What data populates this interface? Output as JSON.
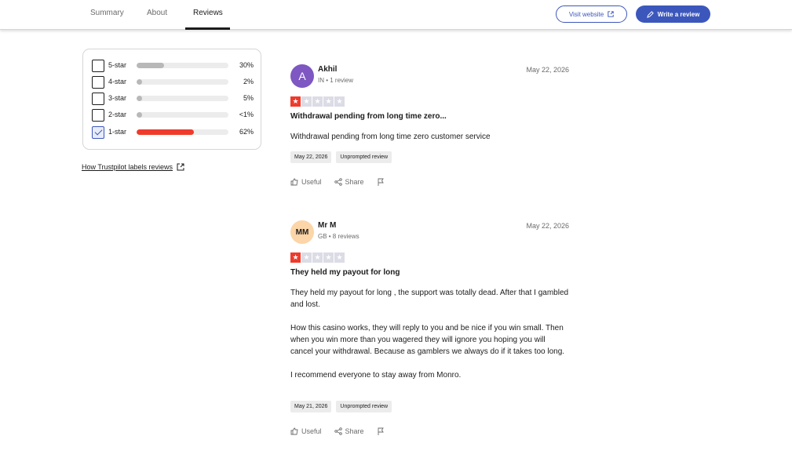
{
  "nav": {
    "tabs": [
      {
        "label": "Summary"
      },
      {
        "label": "About"
      },
      {
        "label": "Reviews"
      }
    ],
    "visit_label": "Visit website",
    "write_label": "Write a review"
  },
  "filters": {
    "rows": [
      {
        "label": "5-star",
        "percent_text": "30%",
        "fill_percent": 30,
        "checked": false
      },
      {
        "label": "4-star",
        "percent_text": "2%",
        "fill_percent": 2,
        "checked": false
      },
      {
        "label": "3-star",
        "percent_text": "5%",
        "fill_percent": 5,
        "checked": false
      },
      {
        "label": "2-star",
        "percent_text": "<1%",
        "fill_percent": 1,
        "checked": false
      },
      {
        "label": "1-star",
        "percent_text": "62%",
        "fill_percent": 62,
        "checked": true
      }
    ],
    "labels_link": "How Trustpilot labels reviews"
  },
  "reviews": [
    {
      "avatar_initials": "A",
      "name": "Akhil",
      "meta": "IN • 1 review",
      "date": "May 22, 2026",
      "rating": 1,
      "title": "Withdrawal pending from long time zero...",
      "body": [
        "Withdrawal pending from long time zero customer service"
      ],
      "tags": [
        "May 22, 2026",
        "Unprompted review"
      ],
      "useful_label": "Useful",
      "share_label": "Share"
    },
    {
      "avatar_initials": "MM",
      "name": "Mr M",
      "meta": "GB • 8 reviews",
      "date": "May 22, 2026",
      "rating": 1,
      "title": "They held my payout for long",
      "body": [
        "They held my payout for long , the support was totally dead. After that I gambled and lost.",
        "How this casino works, they will reply to you and be nice if you win small. Then when you win more than you wagered they will ignore you hoping you will cancel your withdrawal. Because as gamblers we always do if it takes too long.",
        "I recommend everyone to stay away from Monro."
      ],
      "tags": [
        "May 21, 2026",
        "Unprompted review"
      ],
      "useful_label": "Useful",
      "share_label": "Share"
    }
  ],
  "colors": {
    "brand_blue": "#3c57bc",
    "star_red": "#ef3b2c",
    "star_empty": "#dcdce6",
    "avatar_purple": "#7e57c2",
    "avatar_peach": "#fcd5a8"
  }
}
